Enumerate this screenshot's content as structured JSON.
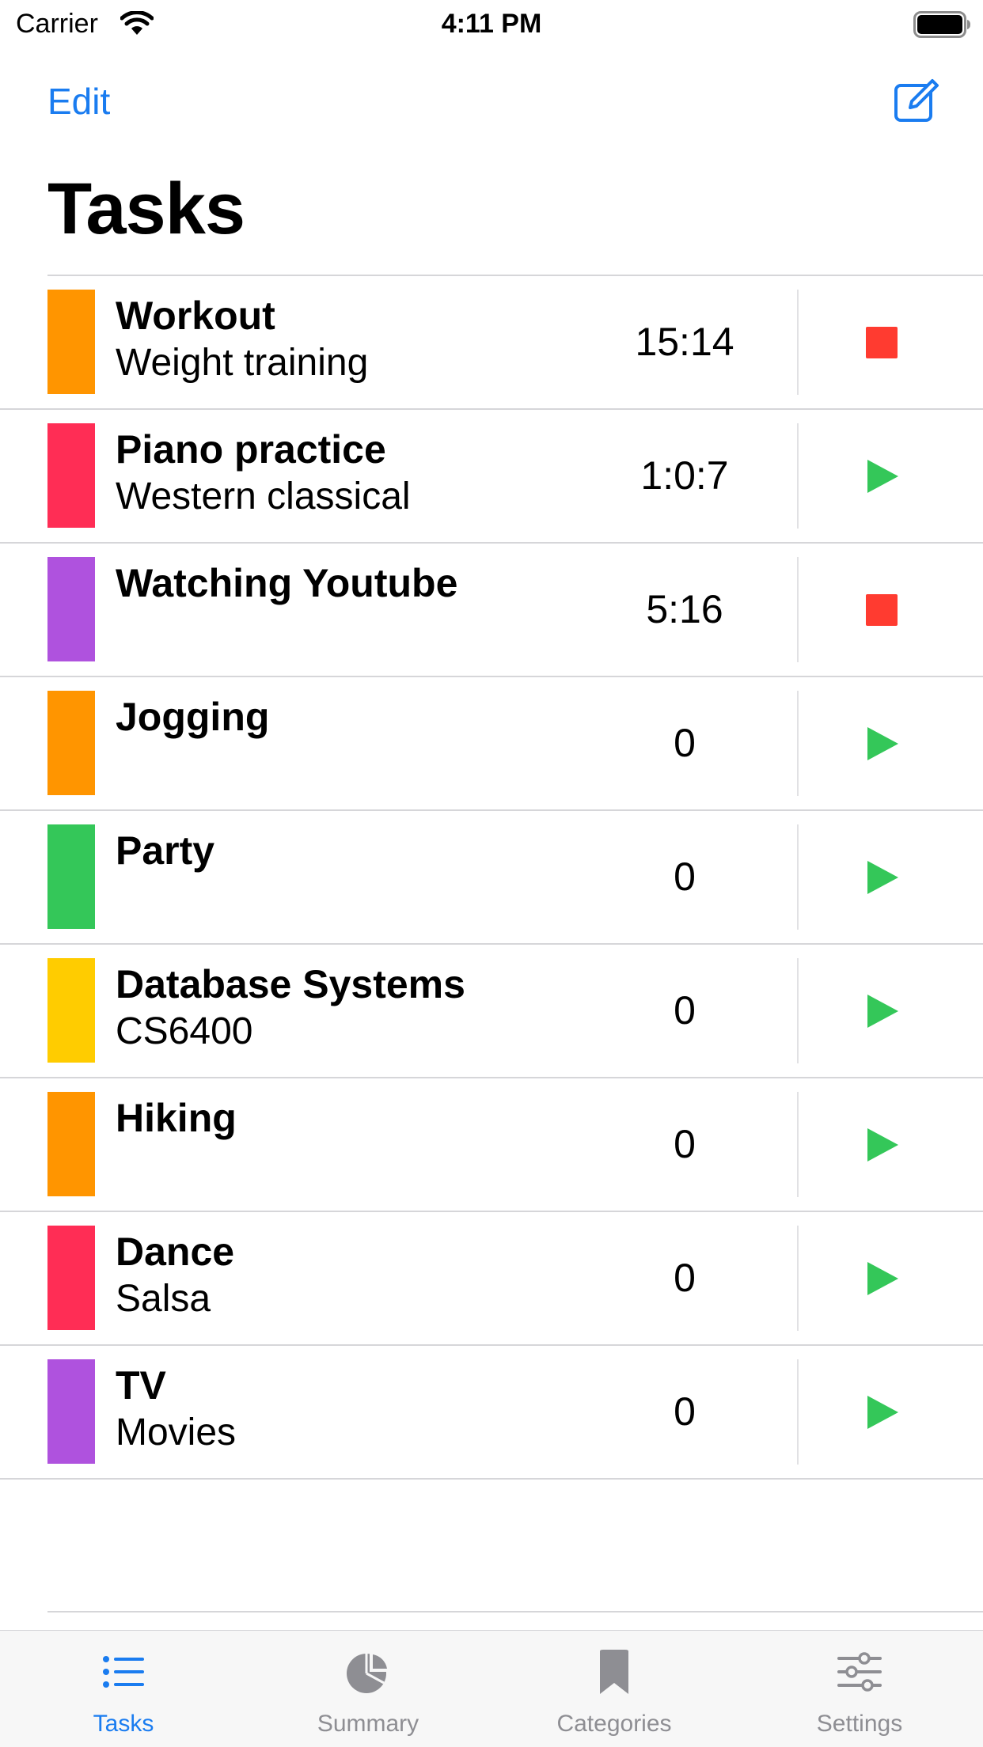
{
  "status_bar": {
    "carrier": "Carrier",
    "time": "4:11 PM",
    "wifi_icon": "wifi-icon",
    "battery_icon": "battery-full-icon"
  },
  "nav": {
    "edit_label": "Edit",
    "compose_icon": "compose-icon",
    "title": "Tasks"
  },
  "colors": {
    "accent": "#1a7cf0",
    "stop": "#ff3b30",
    "play": "#34c759",
    "orange": "#ff9500",
    "pink": "#ff2d55",
    "purple": "#af52de",
    "green": "#34c759",
    "yellow": "#ffcc00"
  },
  "tasks": [
    {
      "name": "Workout",
      "category": "Weight training",
      "time": "15:14",
      "color": "#ff9500",
      "state": "running"
    },
    {
      "name": "Piano practice",
      "category": "Western classical",
      "time": "1:0:7",
      "color": "#ff2d55",
      "state": "stopped"
    },
    {
      "name": "Watching Youtube",
      "category": "",
      "time": "5:16",
      "color": "#af52de",
      "state": "running"
    },
    {
      "name": "Jogging",
      "category": "",
      "time": "0",
      "color": "#ff9500",
      "state": "stopped"
    },
    {
      "name": "Party",
      "category": "",
      "time": "0",
      "color": "#34c759",
      "state": "stopped"
    },
    {
      "name": "Database Systems",
      "category": "CS6400",
      "time": "0",
      "color": "#ffcc00",
      "state": "stopped"
    },
    {
      "name": "Hiking",
      "category": "",
      "time": "0",
      "color": "#ff9500",
      "state": "stopped"
    },
    {
      "name": "Dance",
      "category": "Salsa",
      "time": "0",
      "color": "#ff2d55",
      "state": "stopped"
    },
    {
      "name": "TV",
      "category": "Movies",
      "time": "0",
      "color": "#af52de",
      "state": "stopped"
    }
  ],
  "tab_bar": {
    "items": [
      {
        "label": "Tasks",
        "icon": "list-icon",
        "active": true
      },
      {
        "label": "Summary",
        "icon": "pie-chart-icon",
        "active": false
      },
      {
        "label": "Categories",
        "icon": "bookmark-icon",
        "active": false
      },
      {
        "label": "Settings",
        "icon": "sliders-icon",
        "active": false
      }
    ]
  }
}
